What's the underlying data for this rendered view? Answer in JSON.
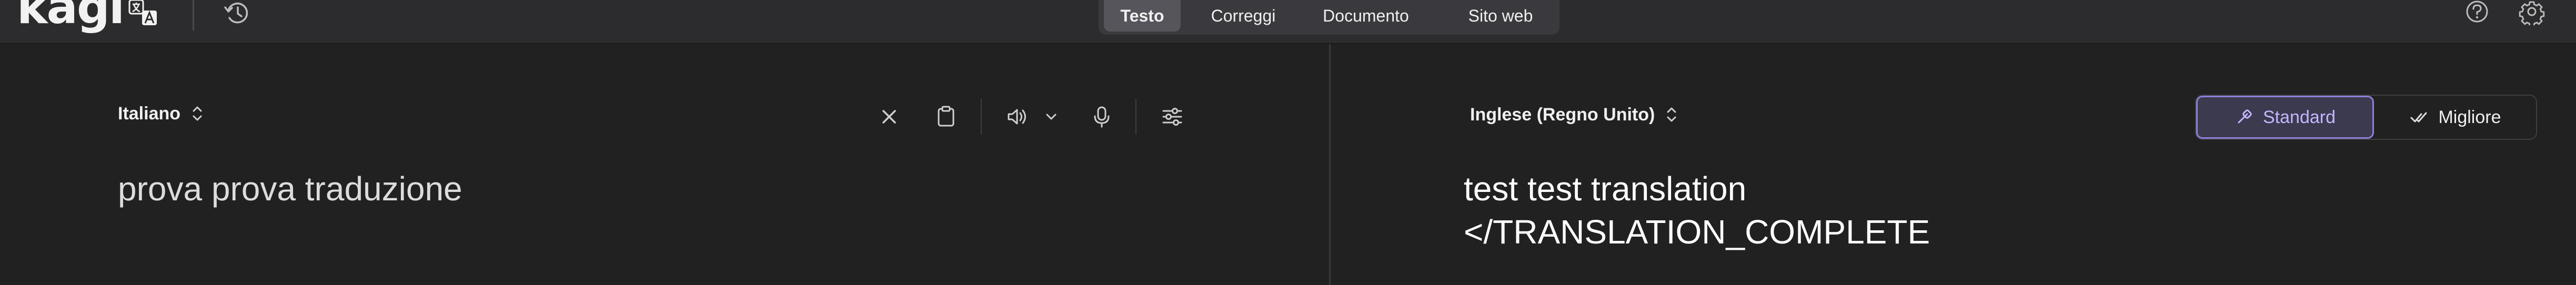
{
  "header": {
    "logo": "kagi",
    "tabs": [
      {
        "label": "Testo",
        "active": true
      },
      {
        "label": "Correggi",
        "active": false
      },
      {
        "label": "Documento",
        "active": false
      },
      {
        "label": "Sito web",
        "active": false
      }
    ]
  },
  "source": {
    "language": "Italiano",
    "text": "prova prova traduzione"
  },
  "target": {
    "language": "Inglese (Regno Unito)",
    "line1": "test test translation",
    "line2": "</TRANSLATION_COMPLETE",
    "quality_options": [
      {
        "label": "Standard",
        "selected": true
      },
      {
        "label": "Migliore",
        "selected": false
      }
    ]
  },
  "colors": {
    "background": "#212121",
    "topbar": "#2c2c2e",
    "accent": "#8d80d8",
    "accent_text": "#c3b6ff"
  }
}
